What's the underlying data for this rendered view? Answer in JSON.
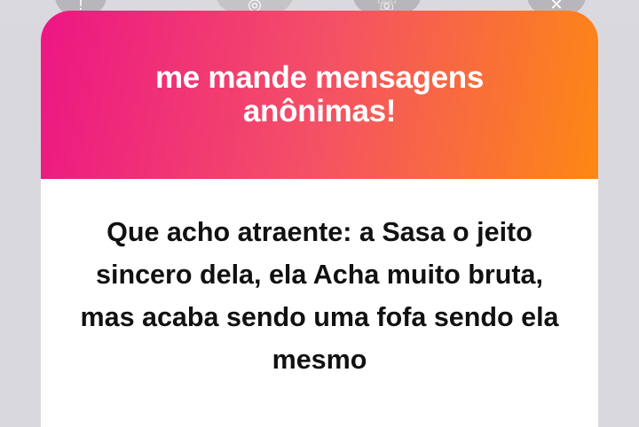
{
  "background_icons": [
    {
      "name": "info-icon",
      "glyph": "!"
    },
    {
      "name": "instagram-icon",
      "glyph": "◎"
    },
    {
      "name": "phone-icon",
      "glyph": "☏"
    },
    {
      "name": "close-icon",
      "glyph": "✕"
    }
  ],
  "card": {
    "title": "me mande mensagens anônimas!",
    "message": "Que acho atraente: a Sasa o jeito sincero dela, ela Acha muito bruta, mas acaba sendo uma fofa sendo ela mesmo"
  },
  "colors": {
    "gradient_start": "#ec1684",
    "gradient_mid": "#f45066",
    "gradient_end": "#fd8813",
    "text": "#111111",
    "card_background": "#ffffff"
  }
}
